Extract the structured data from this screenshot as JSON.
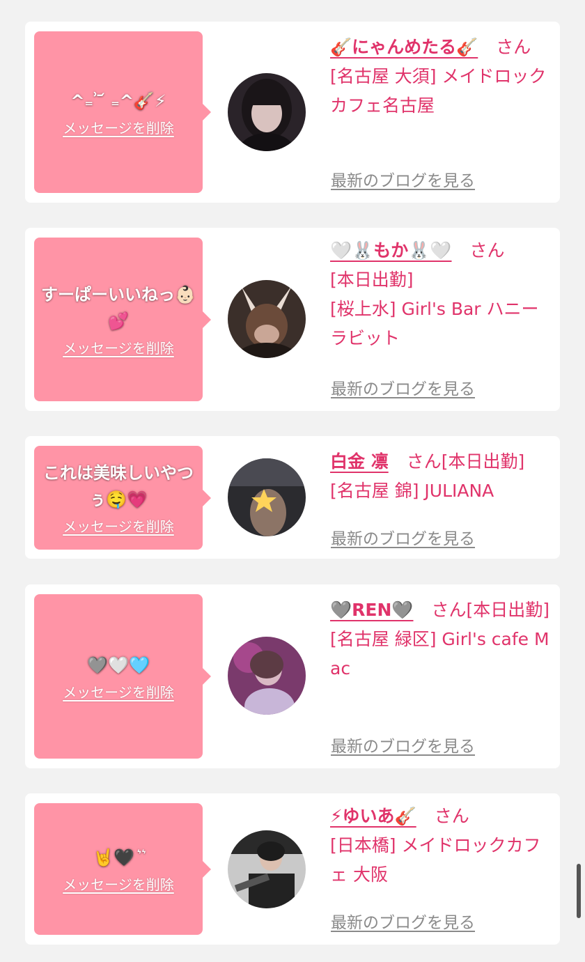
{
  "delete_label": "メッセージを削除",
  "blog_label": "最新のブログを見る",
  "san_label": "さん",
  "colors": {
    "page_bg": "#f2f2f2",
    "bubble": "#ff94a6",
    "accent": "#e0336a",
    "link_gray": "#8a8a8a"
  },
  "entries": [
    {
      "message": "^₌ ͗ ᷄ ₌^🎸⚡",
      "name": "🎸にゃんめたる🎸",
      "lines": [
        "[名古屋 大須] メイドロックカフェ名古屋"
      ]
    },
    {
      "message": "すーぱーいいねっ👶🏻💕",
      "name": "🤍🐰もか🐰🤍",
      "lines": [
        "[本日出勤]",
        "[桜上水] Girl's Bar ハニーラビット"
      ]
    },
    {
      "message": "これは美味しいやつぅ🤤💗",
      "name": "白金 凛",
      "lines": [
        "[本日出勤]",
        "[名古屋 錦] JULIANA"
      ]
    },
    {
      "message": "🩶🤍🩵",
      "name": "🩶REN🩶",
      "lines": [
        "[本日出勤]",
        "[名古屋 緑区] Girl's cafe Mac"
      ]
    },
    {
      "message": "🤘🖤 ͛ ͛",
      "name": "⚡ゆいあ🎸",
      "lines": [
        "[日本橋] メイドロックカフェ 大阪"
      ]
    }
  ]
}
